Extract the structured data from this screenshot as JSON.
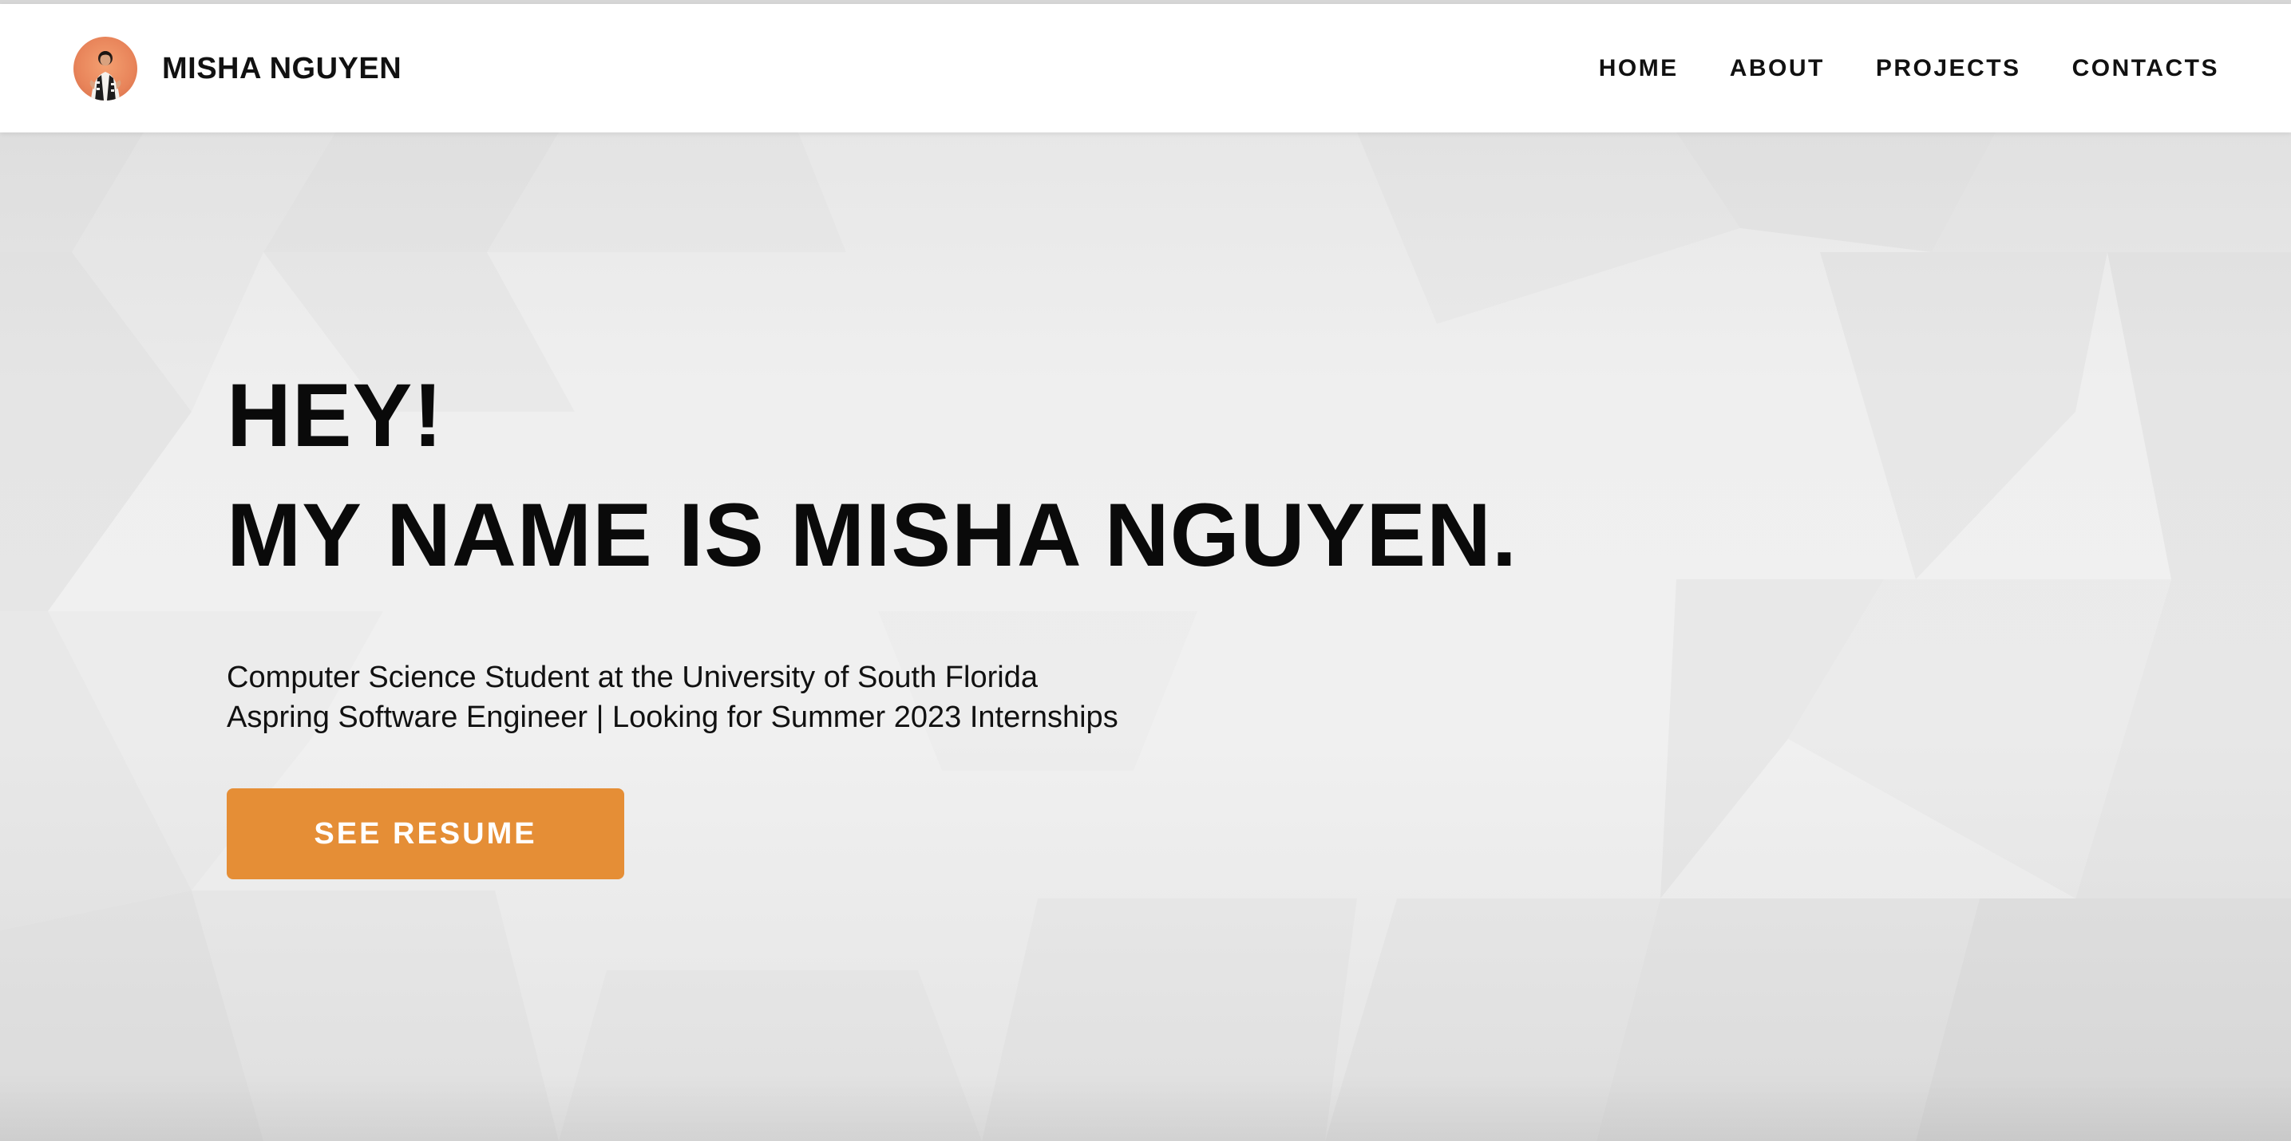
{
  "brand": {
    "name": "MISHA NGUYEN",
    "avatar_icon": "profile-photo"
  },
  "nav": {
    "items": [
      {
        "label": "HOME"
      },
      {
        "label": "ABOUT"
      },
      {
        "label": "PROJECTS"
      },
      {
        "label": "CONTACTS"
      }
    ]
  },
  "hero": {
    "headline_line1": "HEY!",
    "headline_line2": "MY NAME IS MISHA NGUYEN.",
    "subtitle_line1": "Computer Science Student at the University of South Florida",
    "subtitle_line2": "Aspring Software Engineer | Looking for Summer 2023 Internships",
    "cta_label": "SEE RESUME"
  },
  "colors": {
    "accent": "#e58e36",
    "text": "#111111",
    "background": "#efefef",
    "navbar": "#ffffff"
  }
}
